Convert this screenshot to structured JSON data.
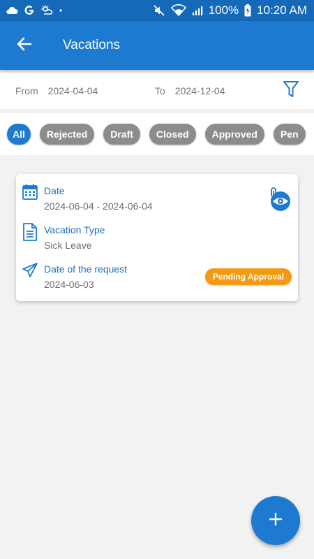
{
  "status_bar": {
    "left_icons": [
      "cloud-icon",
      "google-icon",
      "weather-icon",
      "dot-icon"
    ],
    "right_icons": [
      "mute-icon",
      "wifi-icon",
      "signal-icon",
      "battery-charging-icon"
    ],
    "battery": "100%",
    "time": "10:20 AM"
  },
  "app_bar": {
    "title": "Vacations",
    "back_icon": "arrow-left-icon"
  },
  "date_filter": {
    "from_label": "From",
    "from_value": "2024-04-04",
    "to_label": "To",
    "to_value": "2024-12-04",
    "filter_icon": "funnel-icon"
  },
  "chips": [
    {
      "label": "All",
      "active": true
    },
    {
      "label": "Rejected",
      "active": false
    },
    {
      "label": "Draft",
      "active": false
    },
    {
      "label": "Closed",
      "active": false
    },
    {
      "label": "Approved",
      "active": false
    },
    {
      "label": "Pen",
      "active": false
    }
  ],
  "vacation_card": {
    "date_label": "Date",
    "date_value": "2024-06-04 - 2024-06-04",
    "type_label": "Vacation Type",
    "type_value": "Sick Leave",
    "request_label": "Date of the request",
    "request_value": "2024-06-03",
    "status": "Pending Approval",
    "attachment_icon": "attachment-view-icon"
  },
  "fab": {
    "label": "+"
  },
  "colors": {
    "status_bar": "#1469b8",
    "app_bar": "#1e7ad1",
    "chip_active": "#1e7ad1",
    "chip_inactive": "#8c8c8c",
    "field_label": "#1e6fb9",
    "badge_pending": "#f49a12",
    "background": "#f2f2f2"
  }
}
